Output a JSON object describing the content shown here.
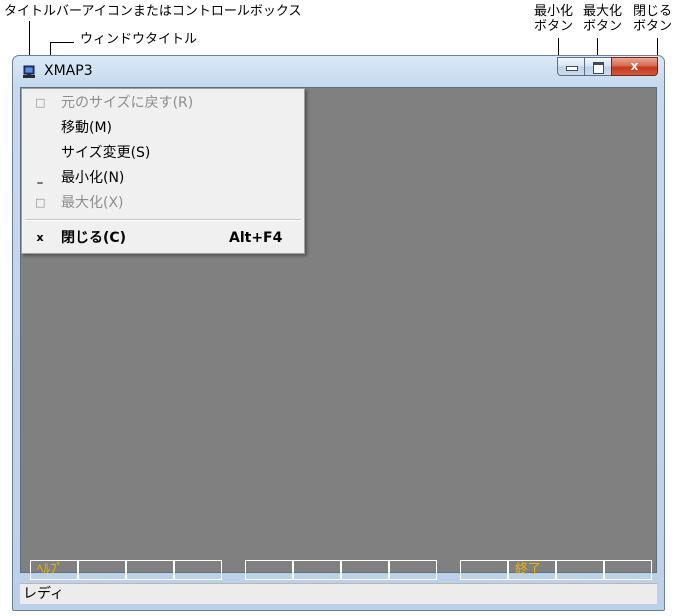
{
  "annotations": {
    "control_box": "タイトルバーアイコンまたはコントロールボックス",
    "window_title": "ウィンドウタイトル",
    "minimize_button": [
      "最小化",
      "ボタン"
    ],
    "maximize_button": [
      "最大化",
      "ボタン"
    ],
    "close_button": [
      "閉じる",
      "ボタン"
    ]
  },
  "window": {
    "title": "XMAP3",
    "icon": "app-icon",
    "caption_icons": [
      "minimize-icon",
      "maximize-icon",
      "close-icon"
    ],
    "close_glyph": "x"
  },
  "system_menu": {
    "items": [
      {
        "icon": "□",
        "label": "元のサイズに戻す(R)",
        "enabled": false
      },
      {
        "icon": "",
        "label": "移動(M)",
        "enabled": true
      },
      {
        "icon": "",
        "label": "サイズ変更(S)",
        "enabled": true
      },
      {
        "icon": "_",
        "label": "最小化(N)",
        "enabled": true
      },
      {
        "icon": "□",
        "label": "最大化(X)",
        "enabled": false
      },
      {
        "icon": "x",
        "label": "閉じる(C)",
        "enabled": true,
        "accelerator": "Alt+F4"
      }
    ]
  },
  "function_keys": [
    "ﾍﾙﾌﾟ",
    "",
    "",
    "",
    "",
    "",
    "",
    "",
    "",
    "終了",
    "",
    ""
  ],
  "status_bar": {
    "text": "レディ"
  },
  "colors": {
    "client_background": "#808080",
    "function_key_text": "#f0b400",
    "close_button": "#c4391d"
  }
}
